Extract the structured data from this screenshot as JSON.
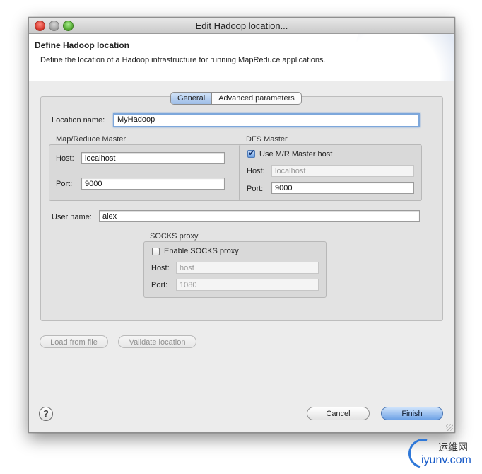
{
  "window": {
    "title": "Edit Hadoop location..."
  },
  "header": {
    "title": "Define Hadoop location",
    "description": "Define the location of a Hadoop infrastructure for running MapReduce applications."
  },
  "tabs": [
    {
      "label": "General",
      "active": true
    },
    {
      "label": "Advanced parameters",
      "active": false
    }
  ],
  "location": {
    "label": "Location name:",
    "value": "MyHadoop"
  },
  "mr_master": {
    "title": "Map/Reduce Master",
    "host_label": "Host:",
    "host_value": "localhost",
    "port_label": "Port:",
    "port_value": "9000"
  },
  "dfs_master": {
    "title": "DFS Master",
    "checkbox_label": "Use M/R Master host",
    "checked": true,
    "host_label": "Host:",
    "host_value": "localhost",
    "port_label": "Port:",
    "port_value": "9000"
  },
  "user": {
    "label": "User name:",
    "value": "alex"
  },
  "socks": {
    "title": "SOCKS proxy",
    "checkbox_label": "Enable SOCKS proxy",
    "checked": false,
    "host_label": "Host:",
    "host_value": "host",
    "port_label": "Port:",
    "port_value": "1080"
  },
  "actions": {
    "load": "Load from file",
    "validate": "Validate location"
  },
  "footer": {
    "help": "?",
    "cancel": "Cancel",
    "finish": "Finish"
  },
  "watermark": {
    "cn": "运维网",
    "url": "iyunv.com"
  }
}
